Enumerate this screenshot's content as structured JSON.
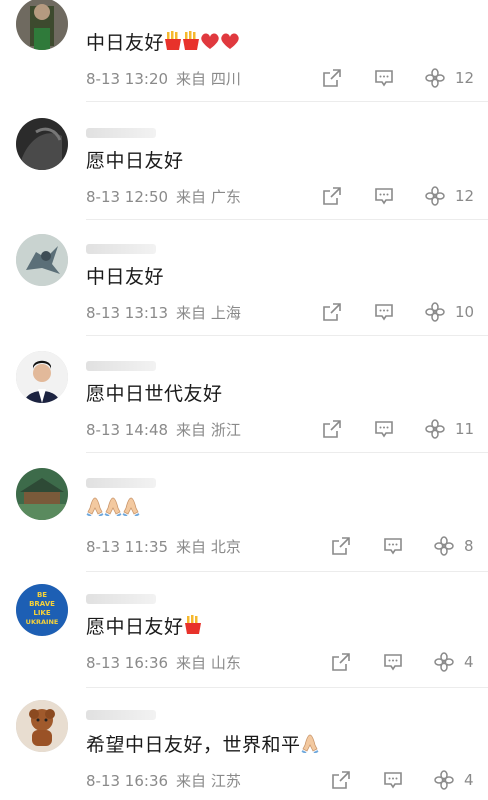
{
  "icons": {
    "share": "share-icon",
    "comment": "comment-icon",
    "like": "like-icon",
    "fries": "fries-emoji",
    "heart": "red-heart-emoji",
    "pray": "folded-hands-emoji"
  },
  "colors": {
    "text": "#1a1a1a",
    "meta": "#8a8a8a",
    "heart": "#e0393e",
    "fries_box": "#e8322b",
    "fries": "#f5b82e"
  },
  "comments": [
    {
      "text": "中日友好",
      "time": "8-13 13:20",
      "location": "来自 四川",
      "likes": "12"
    },
    {
      "text": "愿中日友好",
      "time": "8-13 12:50",
      "location": "来自 广东",
      "likes": "12"
    },
    {
      "text": "中日友好",
      "time": "8-13 13:13",
      "location": "来自 上海",
      "likes": "10"
    },
    {
      "text": "愿中日世代友好",
      "time": "8-13 14:48",
      "location": "来自 浙江",
      "likes": "11"
    },
    {
      "text": "",
      "time": "8-13 11:35",
      "location": "来自 北京",
      "likes": "8"
    },
    {
      "text": "愿中日友好",
      "time": "8-13 16:36",
      "location": "来自 山东",
      "likes": "4"
    },
    {
      "text": "希望中日友好，世界和平",
      "time": "8-13 16:36",
      "location": "来自 江苏",
      "likes": "4"
    }
  ],
  "avatar_badge": [
    "BE",
    "BRAVE",
    "LIKE",
    "UKRAINE"
  ]
}
